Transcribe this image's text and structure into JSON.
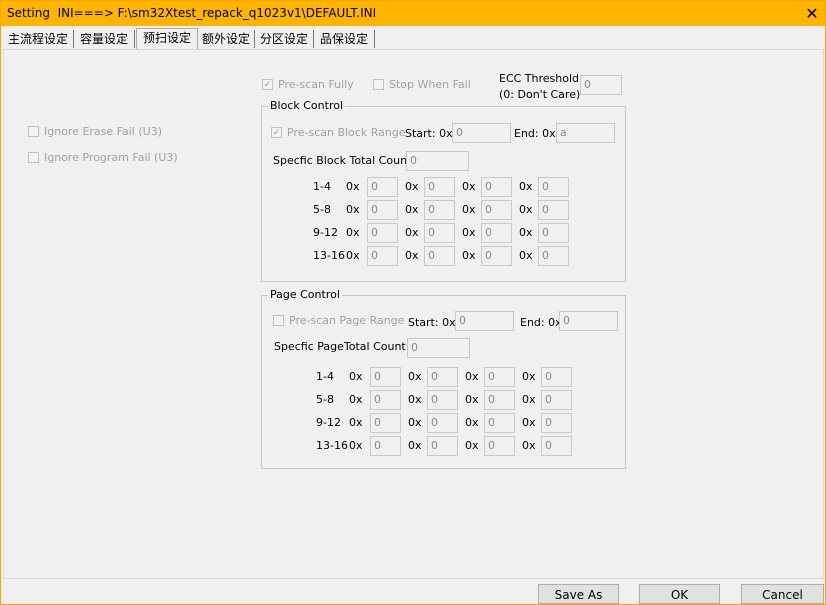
{
  "window": {
    "title": "Setting  INI===> F:\\sm32Xtest_repack_q1023v1\\DEFAULT.INI",
    "close_glyph": "✕",
    "accent_color": "#ffb400"
  },
  "tabs": [
    "主流程设定",
    "容量设定",
    "预扫设定",
    "额外设定",
    "分区设定",
    "品保设定"
  ],
  "active_tab": "预扫设定",
  "left_options": {
    "ignore_erase_fail": "Ignore Erase Fail (U3)",
    "ignore_program_fail": "Ignore Program Fail (U3)"
  },
  "top": {
    "prescan_fully": "Pre-scan Fully",
    "stop_when_fail": "Stop When Fail",
    "ecc_threshold_label": "ECC Threshold:",
    "ecc_threshold_note": "(0: Don't Care)",
    "ecc_threshold_value": "0"
  },
  "block_control": {
    "title": "Block Control",
    "prescan_range": "Pre-scan Block Range",
    "start_label": "Start: 0x",
    "start_value": "0",
    "end_label": "End: 0x",
    "end_value": "a",
    "count_label": "Specfic Block Total Count:",
    "count_value": "0",
    "hex_prefix": "0x",
    "rows": [
      {
        "label": "1-4",
        "values": [
          "0",
          "0",
          "0",
          "0"
        ]
      },
      {
        "label": "5-8",
        "values": [
          "0",
          "0",
          "0",
          "0"
        ]
      },
      {
        "label": "9-12",
        "values": [
          "0",
          "0",
          "0",
          "0"
        ]
      },
      {
        "label": "13-16",
        "values": [
          "0",
          "0",
          "0",
          "0"
        ]
      }
    ]
  },
  "page_control": {
    "title": "Page Control",
    "prescan_range": "Pre-scan Page Range",
    "start_label": "Start: 0x",
    "start_value": "0",
    "end_label": "End: 0x",
    "end_value": "0",
    "count_label": "Specfic PageTotal Count:",
    "count_value": "0",
    "hex_prefix": "0x",
    "rows": [
      {
        "label": "1-4",
        "values": [
          "0",
          "0",
          "0",
          "0"
        ]
      },
      {
        "label": "5-8",
        "values": [
          "0",
          "0",
          "0",
          "0"
        ]
      },
      {
        "label": "9-12",
        "values": [
          "0",
          "0",
          "0",
          "0"
        ]
      },
      {
        "label": "13-16",
        "values": [
          "0",
          "0",
          "0",
          "0"
        ]
      }
    ]
  },
  "buttons": {
    "save_as": "Save  As",
    "ok": "OK",
    "cancel": "Cancel"
  }
}
